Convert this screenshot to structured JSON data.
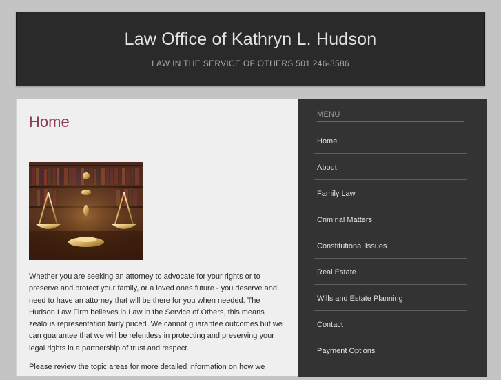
{
  "header": {
    "title": "Law Office of Kathryn L. Hudson",
    "tagline": "LAW IN THE SERVICE OF OTHERS 501 246-3586"
  },
  "main": {
    "title": "Home",
    "image": "scales-of-justice-photo",
    "paragraphs": [
      "Whether you are seeking an attorney to advocate for your rights or to preserve and protect your family, or a loved ones future - you deserve and need to have an attorney that will be there for you when needed. The Hudson Law Firm believes in Law in the Service of Others, this means zealous representation fairly priced.  We cannot guarantee outcomes but we can guarantee that we will be relentless in protecting and preserving your legal rights in a partnership of trust and respect.",
      "Please review the topic areas for more detailed information on how we"
    ]
  },
  "sidebar": {
    "heading": "MENU",
    "items": [
      {
        "label": "Home"
      },
      {
        "label": "About"
      },
      {
        "label": "Family Law"
      },
      {
        "label": "Criminal Matters"
      },
      {
        "label": "Constitutional Issues"
      },
      {
        "label": "Real Estate"
      },
      {
        "label": "Wills and Estate Planning"
      },
      {
        "label": "Contact"
      },
      {
        "label": "Payment Options"
      }
    ]
  },
  "colors": {
    "page_background": "#c4c4c4",
    "header_background": "#2a2a2a",
    "content_background": "#efefef",
    "sidebar_background": "#333333",
    "title_accent": "#8b3a5a"
  }
}
